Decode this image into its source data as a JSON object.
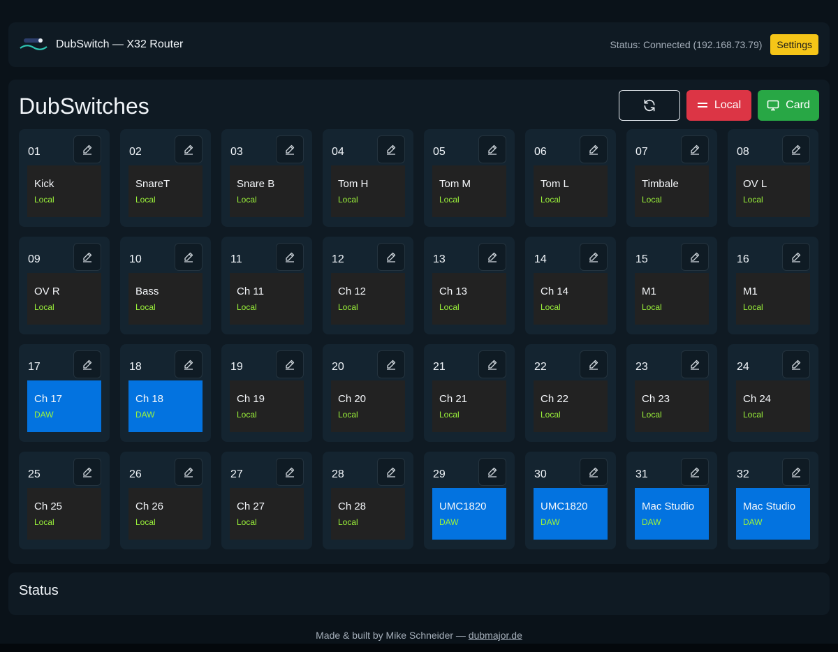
{
  "header": {
    "title": "DubSwitch — X32 Router",
    "status": "Status: Connected (192.168.73.79)",
    "settings_label": "Settings"
  },
  "main": {
    "title": "DubSwitches",
    "buttons": {
      "refresh_icon": "refresh-icon",
      "local_label": "Local",
      "card_label": "Card"
    }
  },
  "switches": [
    {
      "num": "01",
      "name": "Kick",
      "mode": "Local"
    },
    {
      "num": "02",
      "name": "SnareT",
      "mode": "Local"
    },
    {
      "num": "03",
      "name": "Snare B",
      "mode": "Local"
    },
    {
      "num": "04",
      "name": "Tom H",
      "mode": "Local"
    },
    {
      "num": "05",
      "name": "Tom M",
      "mode": "Local"
    },
    {
      "num": "06",
      "name": "Tom L",
      "mode": "Local"
    },
    {
      "num": "07",
      "name": "Timbale",
      "mode": "Local"
    },
    {
      "num": "08",
      "name": "OV L",
      "mode": "Local"
    },
    {
      "num": "09",
      "name": "OV R",
      "mode": "Local"
    },
    {
      "num": "10",
      "name": "Bass",
      "mode": "Local"
    },
    {
      "num": "11",
      "name": "Ch 11",
      "mode": "Local"
    },
    {
      "num": "12",
      "name": "Ch 12",
      "mode": "Local"
    },
    {
      "num": "13",
      "name": "Ch 13",
      "mode": "Local"
    },
    {
      "num": "14",
      "name": "Ch 14",
      "mode": "Local"
    },
    {
      "num": "15",
      "name": "M1",
      "mode": "Local"
    },
    {
      "num": "16",
      "name": "M1",
      "mode": "Local"
    },
    {
      "num": "17",
      "name": "Ch 17",
      "mode": "DAW"
    },
    {
      "num": "18",
      "name": "Ch 18",
      "mode": "DAW"
    },
    {
      "num": "19",
      "name": "Ch 19",
      "mode": "Local"
    },
    {
      "num": "20",
      "name": "Ch 20",
      "mode": "Local"
    },
    {
      "num": "21",
      "name": "Ch 21",
      "mode": "Local"
    },
    {
      "num": "22",
      "name": "Ch 22",
      "mode": "Local"
    },
    {
      "num": "23",
      "name": "Ch 23",
      "mode": "Local"
    },
    {
      "num": "24",
      "name": "Ch 24",
      "mode": "Local"
    },
    {
      "num": "25",
      "name": "Ch 25",
      "mode": "Local"
    },
    {
      "num": "26",
      "name": "Ch 26",
      "mode": "Local"
    },
    {
      "num": "27",
      "name": "Ch 27",
      "mode": "Local"
    },
    {
      "num": "28",
      "name": "Ch 28",
      "mode": "Local"
    },
    {
      "num": "29",
      "name": "UMC1820",
      "mode": "DAW"
    },
    {
      "num": "30",
      "name": "UMC1820",
      "mode": "DAW"
    },
    {
      "num": "31",
      "name": "Mac Studio",
      "mode": "DAW"
    },
    {
      "num": "32",
      "name": "Mac Studio",
      "mode": "DAW"
    }
  ],
  "status_panel": {
    "title": "Status"
  },
  "footer": {
    "text": "Made & built by Mike Schneider — ",
    "link": "dubmajor.de"
  },
  "colors": {
    "local_box": "#222222",
    "daw_box": "#0373e0",
    "mode_text": "#9cf43a",
    "local_button": "#dc3545",
    "card_button": "#28a745",
    "settings_button": "#f5c518"
  }
}
